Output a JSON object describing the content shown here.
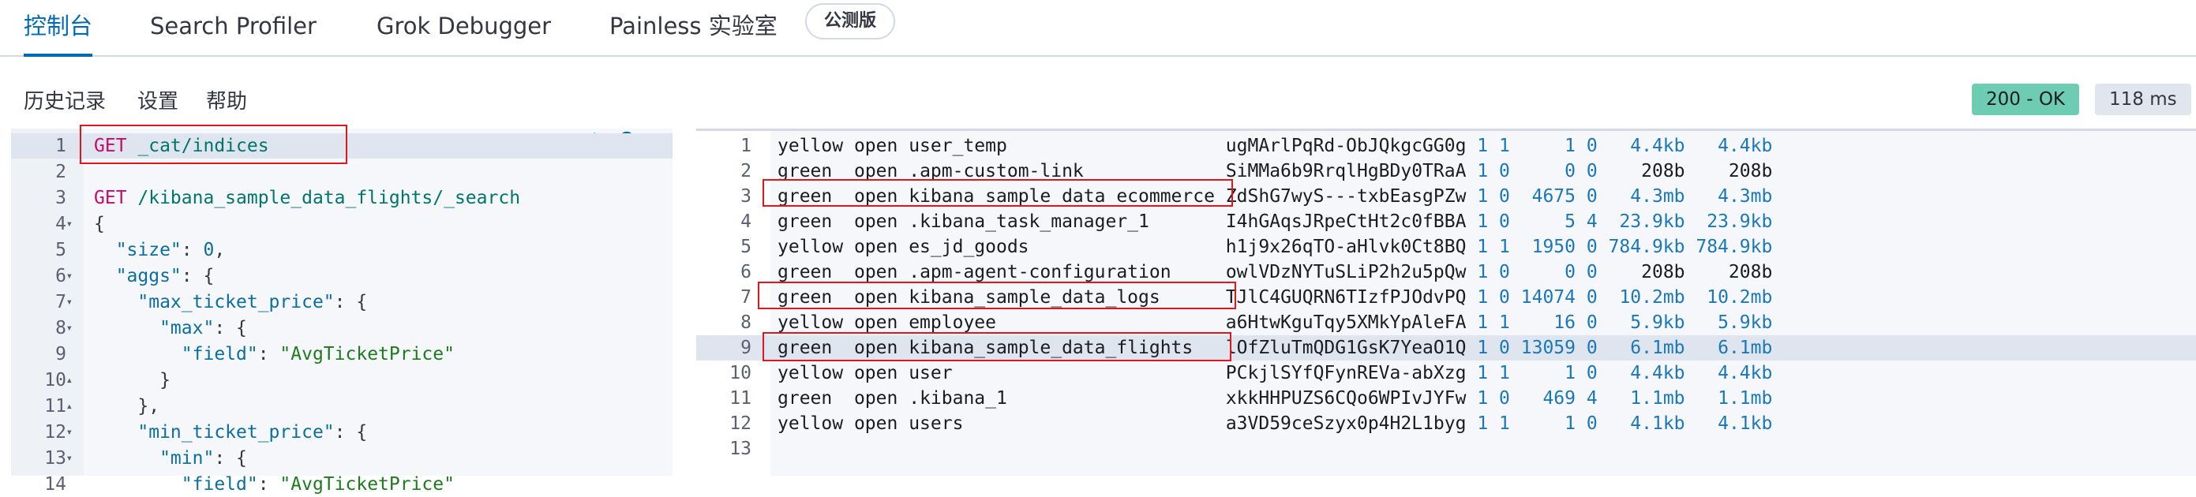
{
  "tabs": [
    {
      "label": "控制台",
      "active": true
    },
    {
      "label": "Search Profiler"
    },
    {
      "label": "Grok Debugger"
    },
    {
      "label": "Painless 实验室"
    }
  ],
  "beta_badge": "公测版",
  "toolbar": {
    "history": "历史记录",
    "settings": "设置",
    "help": "帮助"
  },
  "status": {
    "code": "200 - OK",
    "time": "118 ms",
    "ok_color": "#6dccb1"
  },
  "request_lines": [
    [
      {
        "t": "GET",
        "c": "m"
      },
      {
        "t": " _cat/indices",
        "c": "u"
      }
    ],
    [],
    [
      {
        "t": "GET",
        "c": "m"
      },
      {
        "t": " /kibana_sample_data_flights/_search",
        "c": "u"
      }
    ],
    [
      {
        "t": "{",
        "c": "p"
      }
    ],
    [
      {
        "t": "  \"size\"",
        "c": "k"
      },
      {
        "t": ": ",
        "c": "p"
      },
      {
        "t": "0",
        "c": "n"
      },
      {
        "t": ",",
        "c": "p"
      }
    ],
    [
      {
        "t": "  \"aggs\"",
        "c": "k"
      },
      {
        "t": ": {",
        "c": "p"
      }
    ],
    [
      {
        "t": "    \"max_ticket_price\"",
        "c": "k"
      },
      {
        "t": ": {",
        "c": "p"
      }
    ],
    [
      {
        "t": "      \"max\"",
        "c": "k"
      },
      {
        "t": ": {",
        "c": "p"
      }
    ],
    [
      {
        "t": "        \"field\"",
        "c": "k"
      },
      {
        "t": ": ",
        "c": "p"
      },
      {
        "t": "\"AvgTicketPrice\"",
        "c": "s"
      }
    ],
    [
      {
        "t": "      }",
        "c": "p"
      }
    ],
    [
      {
        "t": "    },",
        "c": "p"
      }
    ],
    [
      {
        "t": "    \"min_ticket_price\"",
        "c": "k"
      },
      {
        "t": ": {",
        "c": "p"
      }
    ],
    [
      {
        "t": "      \"min\"",
        "c": "k"
      },
      {
        "t": ": {",
        "c": "p"
      }
    ],
    [
      {
        "t": "        \"field\"",
        "c": "k"
      },
      {
        "t": ": ",
        "c": "p"
      },
      {
        "t": "\"AvgTicketPrice\"",
        "c": "s"
      }
    ]
  ],
  "fold_markers": {
    "4": "▾",
    "6": "▾",
    "7": "▾",
    "8": "▾",
    "10": "▴",
    "11": "▴",
    "12": "▾",
    "13": "▾"
  },
  "response_rows": [
    [
      "yellow",
      "open",
      "user_temp",
      "ugMArlPqRd-ObJQkgcGG0g",
      "1",
      "1",
      "1",
      "0",
      "4.4kb",
      "4.4kb"
    ],
    [
      "green",
      "open",
      ".apm-custom-link",
      "SiMMa6b9RrqlHgBDy0TRaA",
      "1",
      "0",
      "0",
      "0",
      "208b",
      "208b"
    ],
    [
      "green",
      "open",
      "kibana_sample_data_ecommerce",
      "ZdShG7wyS---txbEasgPZw",
      "1",
      "0",
      "4675",
      "0",
      "4.3mb",
      "4.3mb"
    ],
    [
      "green",
      "open",
      ".kibana_task_manager_1",
      "I4hGAqsJRpeCtHt2c0fBBA",
      "1",
      "0",
      "5",
      "4",
      "23.9kb",
      "23.9kb"
    ],
    [
      "yellow",
      "open",
      "es_jd_goods",
      "h1j9x26qTO-aHlvk0Ct8BQ",
      "1",
      "1",
      "1950",
      "0",
      "784.9kb",
      "784.9kb"
    ],
    [
      "green",
      "open",
      ".apm-agent-configuration",
      "owlVDzNYTuSLiP2h2u5pQw",
      "1",
      "0",
      "0",
      "0",
      "208b",
      "208b"
    ],
    [
      "green",
      "open",
      "kibana_sample_data_logs",
      "TJlC4GUQRN6TIzfPJOdvPQ",
      "1",
      "0",
      "14074",
      "0",
      "10.2mb",
      "10.2mb"
    ],
    [
      "yellow",
      "open",
      "employee",
      "a6HtwKguTqy5XMkYpAleFA",
      "1",
      "1",
      "16",
      "0",
      "5.9kb",
      "5.9kb"
    ],
    [
      "green",
      "open",
      "kibana_sample_data_flights",
      "lOfZluTmQDG1GsK7YeaO1Q",
      "1",
      "0",
      "13059",
      "0",
      "6.1mb",
      "6.1mb"
    ],
    [
      "yellow",
      "open",
      "user",
      "PCkjlSYfQFynREVa-abXzg",
      "1",
      "1",
      "1",
      "0",
      "4.4kb",
      "4.4kb"
    ],
    [
      "green",
      "open",
      ".kibana_1",
      "xkkHHPUZS6CQo6WPIvJYFw",
      "1",
      "0",
      "469",
      "4",
      "1.1mb",
      "1.1mb"
    ],
    [
      "yellow",
      "open",
      "users",
      "a3VD59ceSzyx0p4H2L1byg",
      "1",
      "1",
      "1",
      "0",
      "4.1kb",
      "4.1kb"
    ],
    []
  ]
}
